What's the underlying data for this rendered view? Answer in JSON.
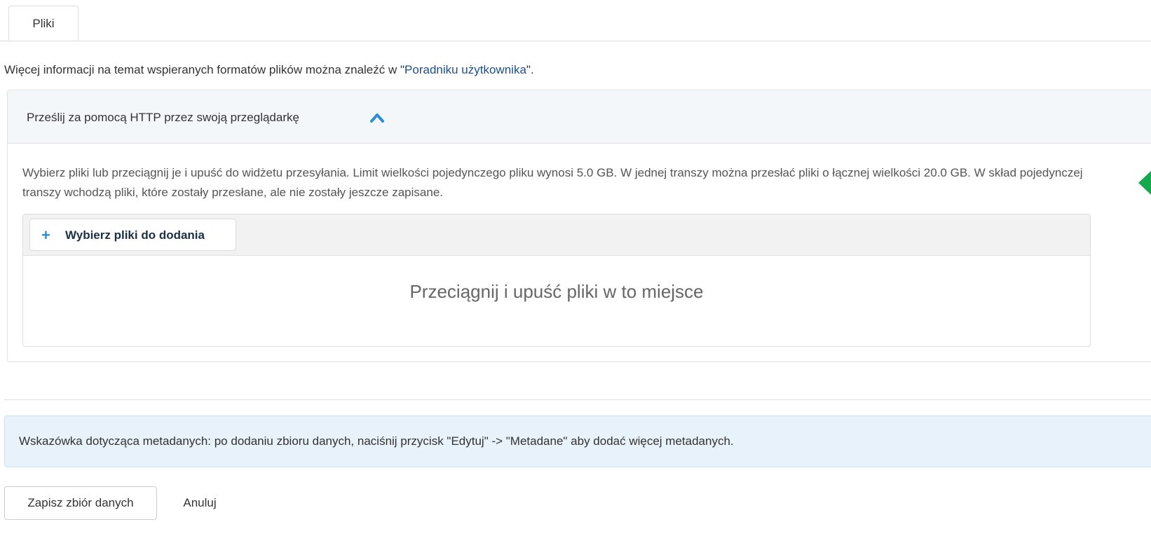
{
  "tabs": [
    {
      "label": "Pliki"
    }
  ],
  "info": {
    "prefix": "Więcej informacji na temat wspieranych formatów plików można znaleźć w \"",
    "link_text": "Poradniku użytkownika",
    "suffix": "\"."
  },
  "upload_panel": {
    "heading": "Prześlij za pomocą HTTP przez swoją przeglądarkę",
    "heading_icon": "chevron-up-icon",
    "description": "Wybierz pliki lub przeciągnij je i upuść do widżetu przesyłania. Limit wielkości pojedynczego pliku wynosi 5.0 GB. W jednej transzy można przesłać pliki o łącznej wielkości 20.0 GB. W skład pojedynczej transzy wchodzą pliki, które zostały przesłane, ale nie zostały jeszcze zapisane.",
    "choose_button": {
      "icon": "plus-icon",
      "label": "Wybierz pliki do dodania"
    },
    "dropzone_text": "Przeciągnij i upuść pliki w to miejsce"
  },
  "metadata_tip": "Wskazówka dotycząca metadanych: po dodaniu zbioru danych, naciśnij przycisk \"Edytuj\" -> \"Metadane\" aby dodać więcej metadanych.",
  "actions": {
    "save_label": "Zapisz zbiór danych",
    "cancel_label": "Anuluj"
  },
  "colors": {
    "link": "#1b4f8c",
    "accent_blue": "#2a8fd6",
    "panel_heading_bg": "#f3f7fa",
    "alert_bg": "#e8f2fb",
    "marker_green": "#13a94d"
  }
}
